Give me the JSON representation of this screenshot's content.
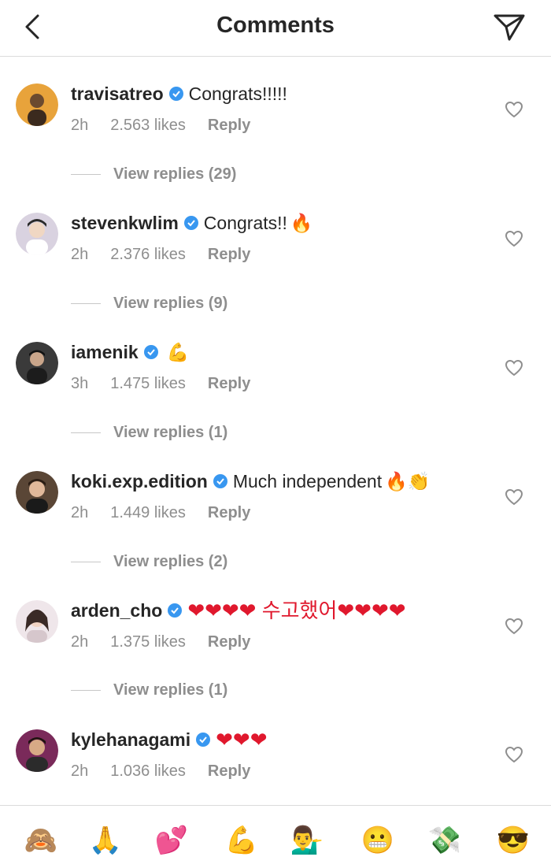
{
  "header": {
    "title": "Comments"
  },
  "comments": [
    {
      "username": "travisatreo",
      "text": "Congrats!!!!!",
      "emoji": "",
      "time": "2h",
      "likes": "2.563 likes",
      "reply": "Reply",
      "view_replies": "View replies (29)"
    },
    {
      "username": "stevenkwlim",
      "text": "Congrats!!",
      "emoji": "🔥",
      "time": "2h",
      "likes": "2.376 likes",
      "reply": "Reply",
      "view_replies": "View replies (9)"
    },
    {
      "username": "iamenik",
      "text": "",
      "emoji": "💪",
      "time": "3h",
      "likes": "1.475 likes",
      "reply": "Reply",
      "view_replies": "View replies (1)"
    },
    {
      "username": "koki.exp.edition",
      "text": "Much independent",
      "emoji": "🔥👏",
      "time": "2h",
      "likes": "1.449 likes",
      "reply": "Reply",
      "view_replies": "View replies (2)"
    },
    {
      "username": "arden_cho",
      "text": "❤❤❤❤ 수고했어❤❤❤❤",
      "emoji": "",
      "time": "2h",
      "likes": "1.375 likes",
      "reply": "Reply",
      "view_replies": "View replies (1)"
    },
    {
      "username": "kylehanagami",
      "text": "❤❤❤",
      "emoji": "",
      "time": "2h",
      "likes": "1.036 likes",
      "reply": "Reply",
      "view_replies": ""
    }
  ],
  "emoji_bar": [
    "🙈",
    "🙏",
    "💕",
    "💪",
    "💁‍♂️",
    "😬",
    "💸",
    "😎"
  ],
  "colors": {
    "verified": "#3897f0",
    "heart": "#e0182d",
    "muted": "#8e8e8e",
    "divider": "#dbdbdb"
  }
}
